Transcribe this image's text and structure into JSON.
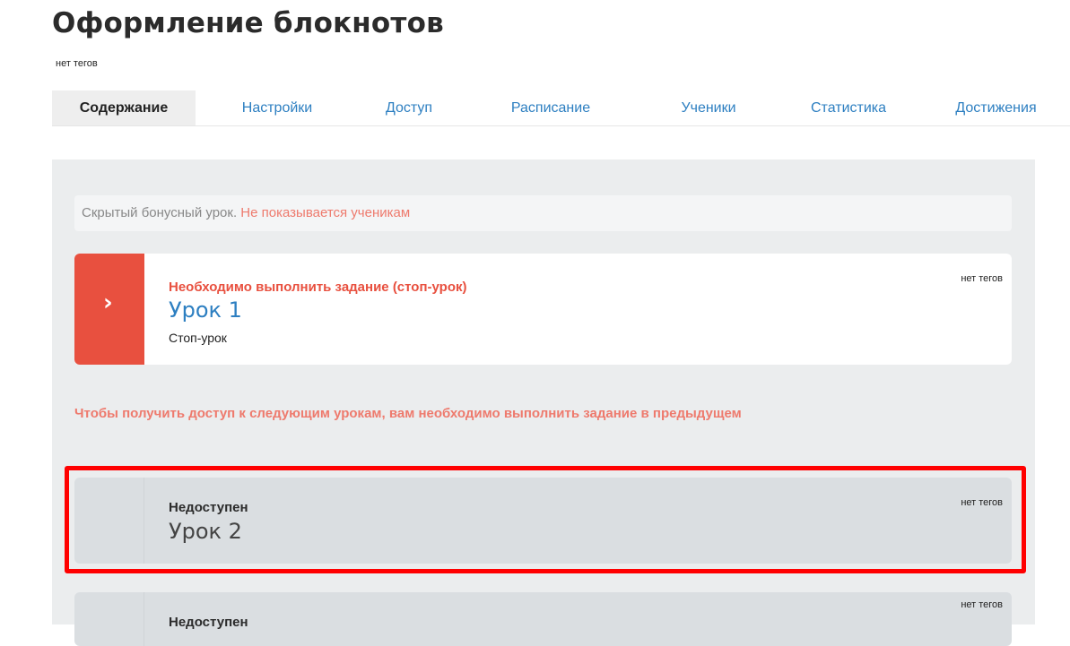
{
  "header": {
    "title": "Оформление блокнотов",
    "tags": "нет тегов"
  },
  "tabs": [
    {
      "label": "Содержание",
      "active": true
    },
    {
      "label": "Настройки"
    },
    {
      "label": "Доступ"
    },
    {
      "label": "Расписание"
    },
    {
      "label": "Ученики"
    },
    {
      "label": "Статистика"
    },
    {
      "label": "Достижения"
    }
  ],
  "notice": {
    "text": "Скрытый бонусный урок.",
    "warning": "Не показывается ученикам"
  },
  "lessons": [
    {
      "status": "Необходимо выполнить задание (стоп-урок)",
      "title": "Урок 1",
      "type": "Стоп-урок",
      "tags": "нет тегов",
      "icon": "chevron-right-icon"
    },
    {
      "status": "Недоступен",
      "title": "Урок 2",
      "tags": "нет тегов"
    },
    {
      "status": "Недоступен",
      "tags": "нет тегов"
    }
  ],
  "access_note": "Чтобы получить доступ к следующим урокам, вам необходимо выполнить задание в предыдущем",
  "colors": {
    "accent": "#2d7fc1",
    "stop": "#e8503f",
    "warning_text": "#ee7a6d",
    "highlight": "#ff0000"
  }
}
